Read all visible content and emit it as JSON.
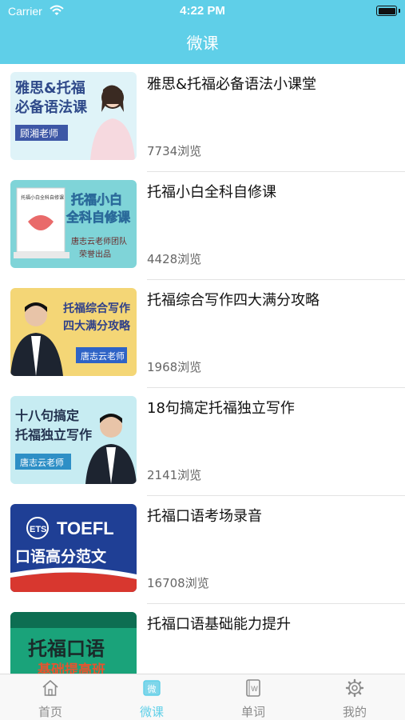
{
  "status_bar": {
    "carrier": "Carrier",
    "time": "4:22 PM"
  },
  "nav": {
    "title": "微课"
  },
  "courses": [
    {
      "title": "雅思&托福必备语法小课堂",
      "views": "7734浏览",
      "thumb_lines": [
        "雅思&托福",
        "必备语法课"
      ],
      "thumb_tag": "顾湘老师"
    },
    {
      "title": "托福小白全科自修课",
      "views": "4428浏览",
      "thumb_lines": [
        "托福小白",
        "全科自修课"
      ],
      "thumb_tag": "唐志云老师团队",
      "thumb_tag2": "荣誉出品",
      "book_label": "托福小白全科自修课"
    },
    {
      "title": "托福综合写作四大满分攻略",
      "views": "1968浏览",
      "thumb_lines": [
        "托福综合写作",
        "四大满分攻略"
      ],
      "thumb_tag": "唐志云老师"
    },
    {
      "title": "18句搞定托福独立写作",
      "views": "2141浏览",
      "thumb_lines": [
        "十八句搞定",
        "托福独立写作"
      ],
      "thumb_tag": "唐志云老师"
    },
    {
      "title": "托福口语考场录音",
      "views": "16708浏览",
      "thumb_lines": [
        "TOEFL",
        "口语高分范文"
      ],
      "thumb_tag": "ETS"
    },
    {
      "title": "托福口语基础能力提升",
      "views": "",
      "thumb_lines": [
        "托福口语",
        "基础提高班"
      ]
    }
  ],
  "tabbar": {
    "items": [
      {
        "label": "首页",
        "icon": "home-icon"
      },
      {
        "label": "微课",
        "icon": "microlesson-icon",
        "glyph": "微"
      },
      {
        "label": "单词",
        "icon": "word-book-icon",
        "glyph": "W"
      },
      {
        "label": "我的",
        "icon": "gear-icon"
      }
    ],
    "active_index": 1
  },
  "colors": {
    "accent": "#5fcfe8",
    "tab_inactive": "#8a8a8a"
  }
}
